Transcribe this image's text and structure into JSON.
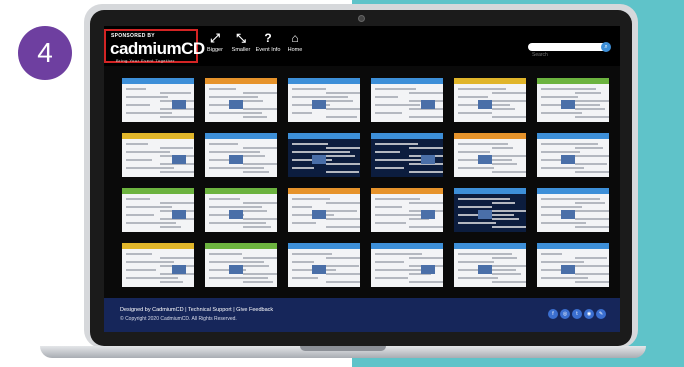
{
  "step_badge": "4",
  "colors": {
    "teal": "#5fc3c9",
    "badge": "#6e3fa0",
    "highlight": "#d32424",
    "footer": "#16265a",
    "accent": "#3d8fd8"
  },
  "header": {
    "sponsor_label": "SPONSORED BY",
    "brand_name": "cadmiumCD",
    "tagline": "Bring Your Event Together",
    "tools": [
      {
        "glyph": "⤢",
        "label": "Bigger",
        "icon": "expand-icon"
      },
      {
        "glyph": "⤡",
        "label": "Smaller",
        "icon": "shrink-icon"
      },
      {
        "glyph": "?",
        "label": "Event Info",
        "icon": "question-icon"
      },
      {
        "glyph": "⌂",
        "label": "Home",
        "icon": "home-icon"
      }
    ],
    "search_placeholder": "Search",
    "search_button_glyph": "⌕"
  },
  "footer": {
    "links": "Designed by CadmiumCD  |  Technical Support  |  Give Feedback",
    "copyright": "© Copyright 2020 CadmiumCD. All Rights Reserved.",
    "social_glyphs": [
      "f",
      "◎",
      "t",
      "◉",
      "✎"
    ]
  }
}
